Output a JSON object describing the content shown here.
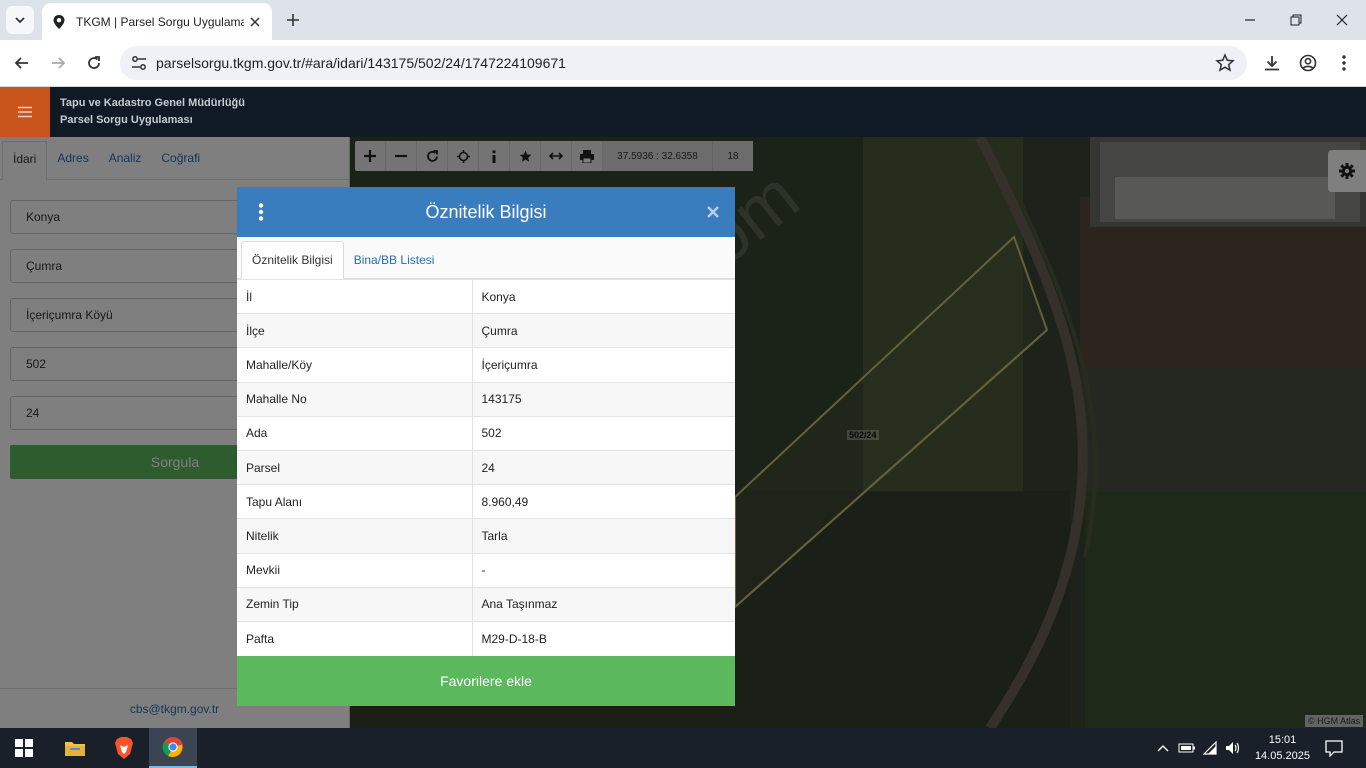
{
  "browser": {
    "tab_title": "TKGM | Parsel Sorgu Uygulaması",
    "url": "parselsorgu.tkgm.gov.tr/#ara/idari/143175/502/24/1747224109671"
  },
  "app": {
    "title_line1": "Tapu ve Kadastro Genel Müdürlüğü",
    "title_line2": "Parsel Sorgu Uygulaması"
  },
  "map_toolbar": {
    "coords": "37.5936 : 32.6358",
    "zoom": "18",
    "parcel_label": "502/24",
    "attribution": "© HGM Atlas",
    "watermark": "emlakjet.com"
  },
  "left_panel": {
    "tabs": [
      "İdari",
      "Adres",
      "Analiz",
      "Coğrafi"
    ],
    "fields": [
      "Konya",
      "Çumra",
      "İçeriçumra Köyü",
      "502",
      "24"
    ],
    "query_button": "Sorgula",
    "contact": "cbs@tkgm.gov.tr"
  },
  "modal": {
    "title": "Öznitelik Bilgisi",
    "tabs": [
      "Öznitelik Bilgisi",
      "Bina/BB Listesi"
    ],
    "rows": [
      {
        "key": "İl",
        "value": "Konya"
      },
      {
        "key": "İlçe",
        "value": "Çumra"
      },
      {
        "key": "Mahalle/Köy",
        "value": "İçeriçumra"
      },
      {
        "key": "Mahalle No",
        "value": "143175"
      },
      {
        "key": "Ada",
        "value": "502"
      },
      {
        "key": "Parsel",
        "value": "24"
      },
      {
        "key": "Tapu Alanı",
        "value": "8.960,49"
      },
      {
        "key": "Nitelik",
        "value": "Tarla"
      },
      {
        "key": "Mevkii",
        "value": "-"
      },
      {
        "key": "Zemin Tip",
        "value": "Ana Taşınmaz"
      },
      {
        "key": "Pafta",
        "value": "M29-D-18-B"
      }
    ],
    "favorite_button": "Favorilere ekle"
  },
  "taskbar": {
    "time": "15:01",
    "date": "14.05.2025"
  }
}
